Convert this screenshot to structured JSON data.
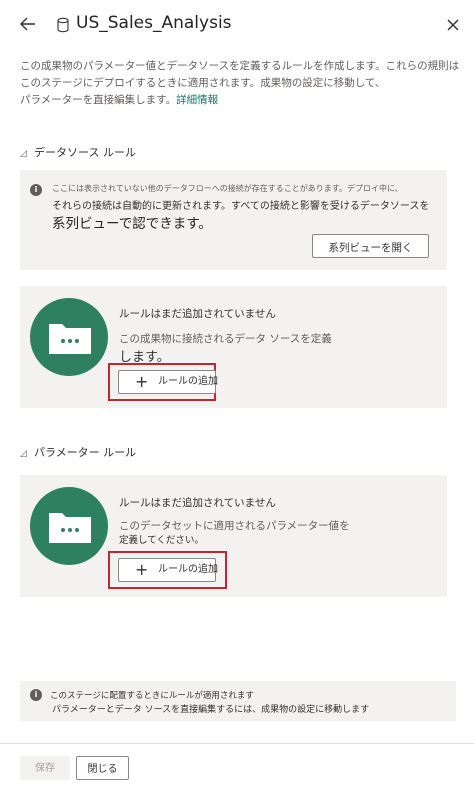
{
  "header": {
    "title": "US_Sales_Analysis"
  },
  "intro": {
    "line1": "この成果物のパラメーター値とデータソースを定義するルールを作成します。これらの規則は",
    "line2": "このステージにデプロイするときに適用されます。成果物の設定に移動して、",
    "line3": "パラメーターを直接編集します。",
    "link": "詳細情報"
  },
  "datasource_section": {
    "heading": "データソース ルール",
    "info": {
      "line1": "ここには表示されていない他のデータフローへの接続が存在することがあります。デプロイ中に、",
      "line2": "それらの接続は自動的に更新されます。すべての接続と影響を受けるデータソースを",
      "line3": "系列ビューで認できます。",
      "button_label": "系列ビューを開く"
    },
    "empty": {
      "title": "ルールはまだ追加されていません",
      "desc_line1": "この成果物に接続されるデータ ソースを定義",
      "desc_line2": "します。",
      "add_label": "ルールの追加"
    }
  },
  "parameter_section": {
    "heading": "パラメーター ルール",
    "empty": {
      "title": "ルールはまだ追加されていません",
      "desc_line1": "このデータセットに適用されるパラメーター値を",
      "desc_line2": "定義してください。",
      "add_label": "ルールの追加"
    }
  },
  "bottom_info": {
    "line1": "このステージに配置するときにルールが適用されます",
    "line2": "パラメーターとデータ ソースを直接編集するには、成果物の設定に移動します"
  },
  "footer": {
    "save_label": "保存",
    "close_label": "閉じる"
  },
  "colors": {
    "accent_green": "#2e8063",
    "link_green": "#0e7a6d",
    "highlight_red": "#c4262e",
    "panel_gray": "#f3f2f1"
  },
  "icons": {
    "back": "arrow-left-icon",
    "dataset": "database-icon",
    "close": "close-icon",
    "collapse": "triangle-collapse-icon",
    "info": "info-icon",
    "folder": "folder-icon",
    "add": "plus-icon"
  }
}
